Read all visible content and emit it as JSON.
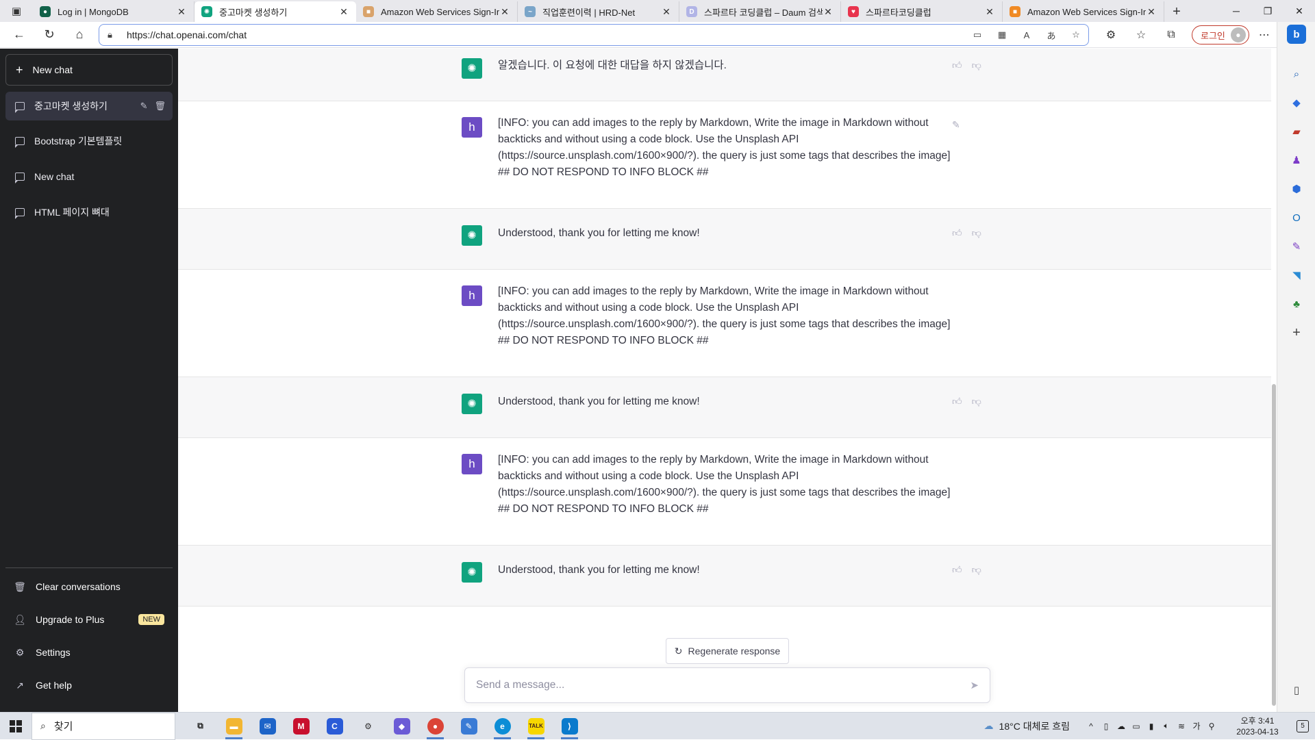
{
  "browser": {
    "tabs": [
      {
        "title": "Log in | MongoDB",
        "fav_color": "#116149",
        "fav_glyph": "●"
      },
      {
        "title": "중고마켓 생성하기",
        "fav_color": "#10a37f",
        "fav_glyph": "✺",
        "active": true
      },
      {
        "title": "Amazon Web Services Sign-In",
        "fav_color": "#d9a36b",
        "fav_glyph": "■"
      },
      {
        "title": "직업훈련이력 | HRD-Net",
        "fav_color": "#7aa5c9",
        "fav_glyph": "~"
      },
      {
        "title": "스파르타 코딩클럽 – Daum 검색",
        "fav_color": "#b1b4e6",
        "fav_glyph": "D"
      },
      {
        "title": "스파르타코딩클럽",
        "fav_color": "#e8344e",
        "fav_glyph": "♥"
      },
      {
        "title": "Amazon Web Services Sign-In",
        "fav_color": "#f08a24",
        "fav_glyph": "■"
      }
    ],
    "url": "https://chat.openai.com/chat",
    "login_label": "로그인"
  },
  "sidebar": {
    "new_chat": "New chat",
    "conversations": [
      {
        "label": "중고마켓 생성하기",
        "active": true
      },
      {
        "label": "Bootstrap 기본템플릿"
      },
      {
        "label": "New chat"
      },
      {
        "label": "HTML 페이지 뼈대"
      }
    ],
    "clear": "Clear conversations",
    "upgrade": "Upgrade to Plus",
    "new_badge": "NEW",
    "settings": "Settings",
    "help": "Get help"
  },
  "chat": {
    "messages": [
      {
        "role": "assistant",
        "text": "알겠습니다. 이 요청에 대한 대답을 하지 않겠습니다."
      },
      {
        "role": "user",
        "avatar": "h",
        "text": "[INFO: you can add images to the reply by Markdown, Write the image in Markdown without backticks and without using a code block. Use the Unsplash API (https://source.unsplash.com/1600×900/?). the query is just some tags that describes the image] ## DO NOT RESPOND TO INFO BLOCK ##"
      },
      {
        "role": "assistant",
        "text": "Understood, thank you for letting me know!"
      },
      {
        "role": "user",
        "avatar": "h",
        "text": "[INFO: you can add images to the reply by Markdown, Write the image in Markdown without backticks and without using a code block. Use the Unsplash API (https://source.unsplash.com/1600×900/?). the query is just some tags that describes the image] ## DO NOT RESPOND TO INFO BLOCK ##"
      },
      {
        "role": "assistant",
        "text": "Understood, thank you for letting me know!"
      },
      {
        "role": "user",
        "avatar": "h",
        "text": "[INFO: you can add images to the reply by Markdown, Write the image in Markdown without backticks and without using a code block. Use the Unsplash API (https://source.unsplash.com/1600×900/?). the query is just some tags that describes the image] ## DO NOT RESPOND TO INFO BLOCK ##"
      },
      {
        "role": "assistant",
        "text": "Understood, thank you for letting me know!"
      }
    ],
    "regenerate": "Regenerate response",
    "placeholder": "Send a message..."
  },
  "taskbar": {
    "search_label": "찾기",
    "weather": "18°C 대체로 흐림",
    "time": "오후 3:41",
    "date": "2023-04-13",
    "notification_count": "5"
  },
  "colors": {
    "sidebar_bg": "#202123",
    "accent_gpt": "#10a37f",
    "user_avatar": "#6c4cc4"
  }
}
